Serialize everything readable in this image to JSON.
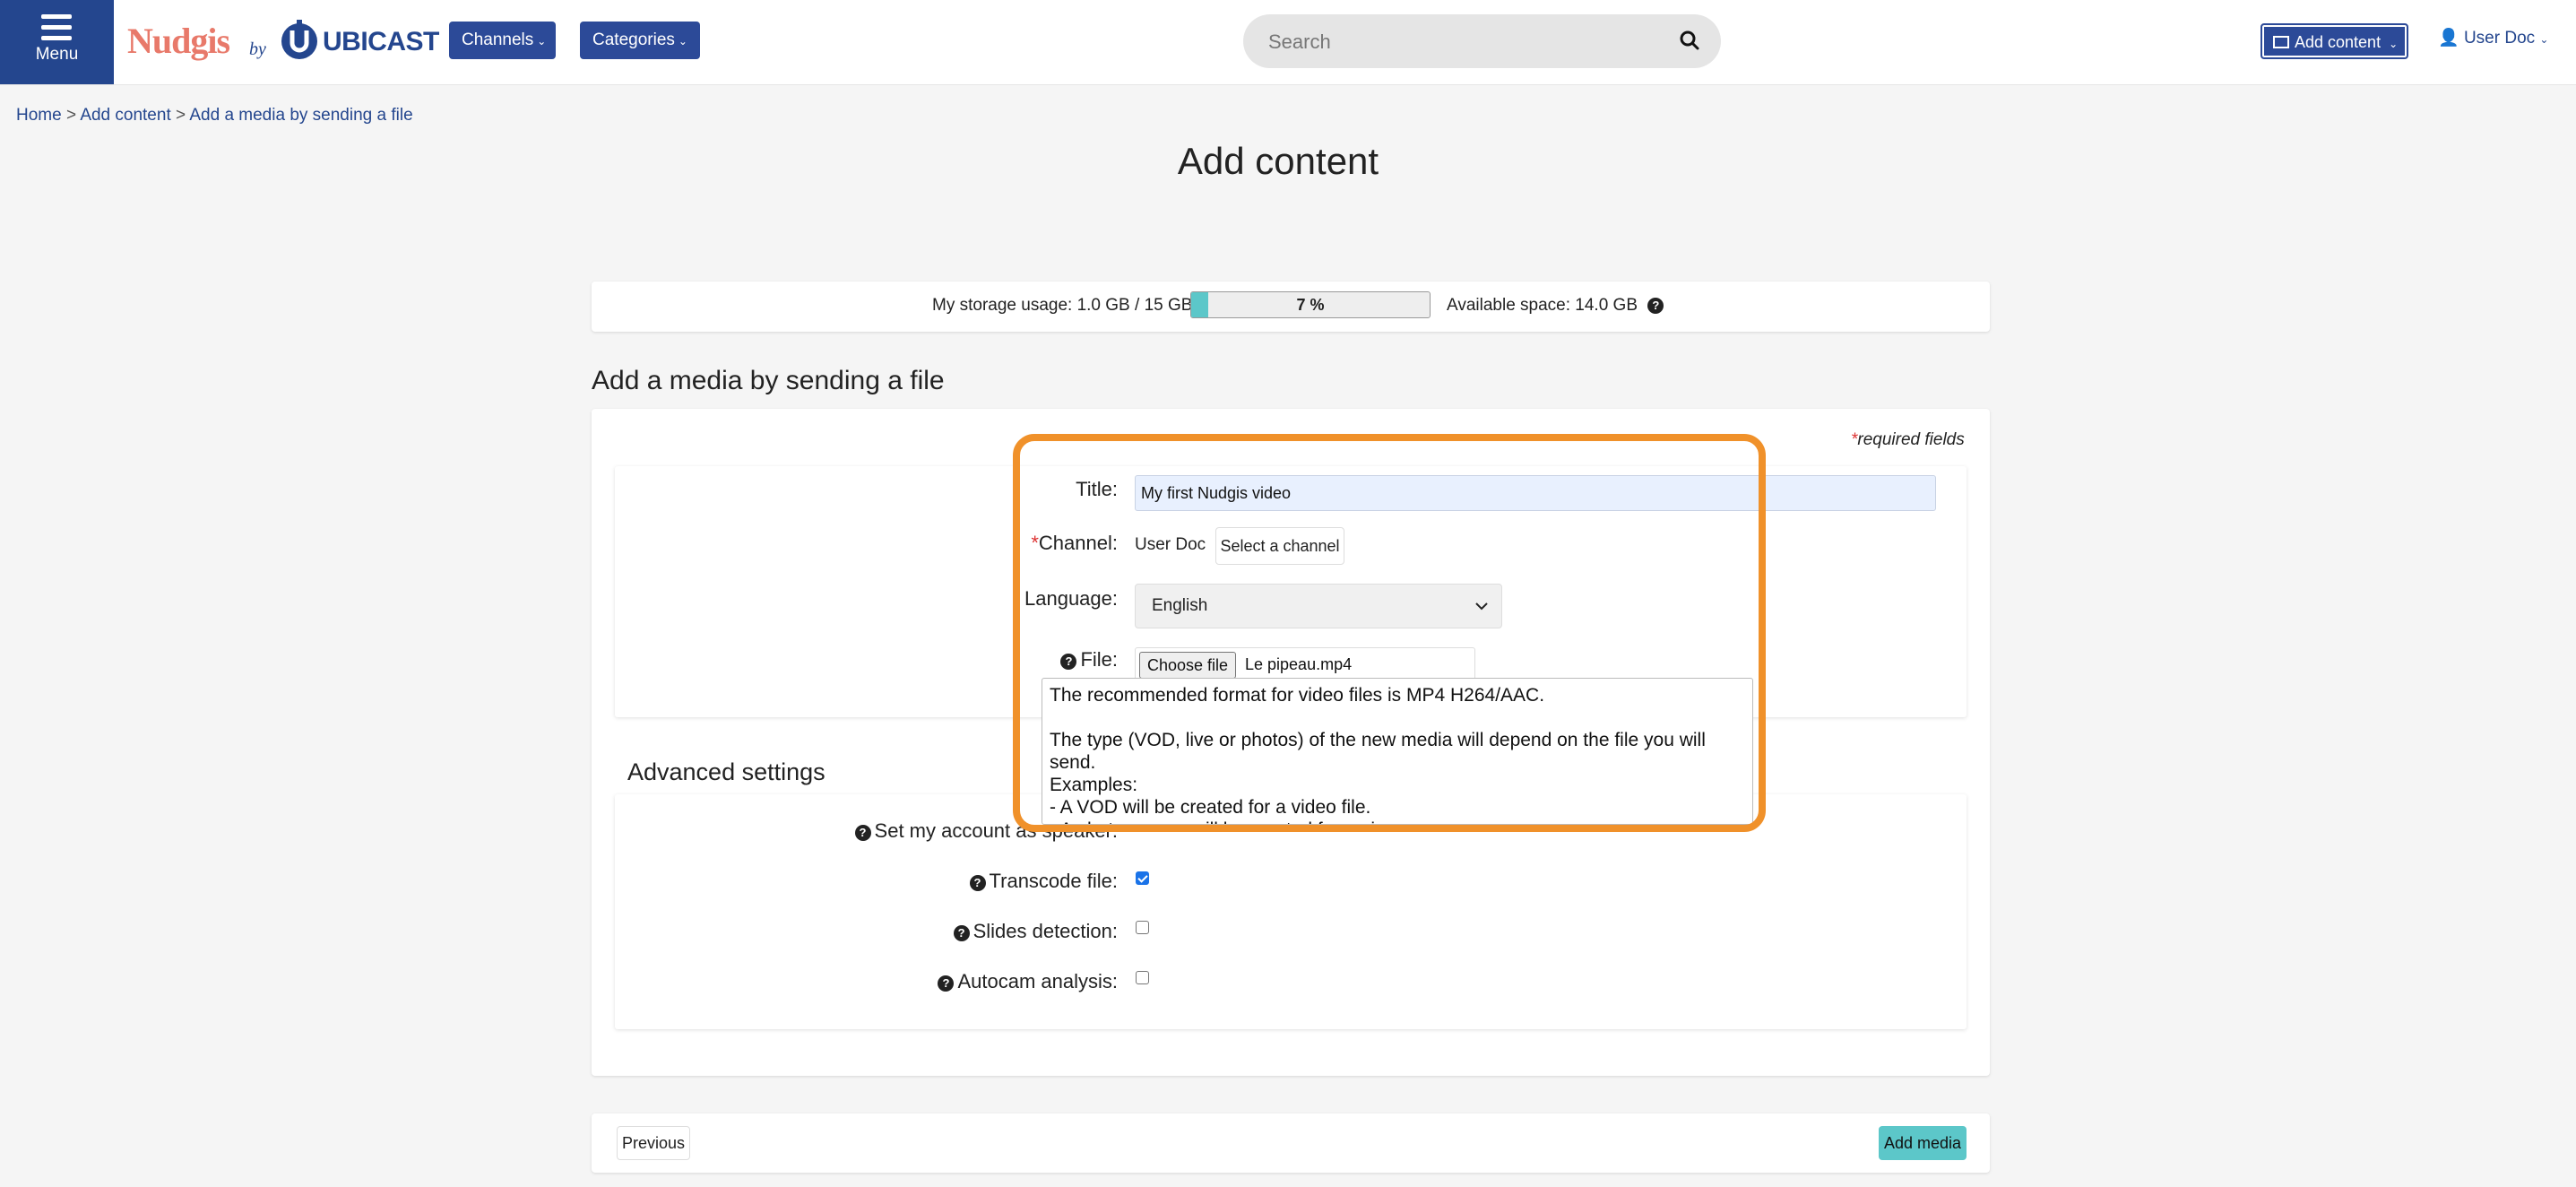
{
  "header": {
    "menu_label": "Menu",
    "logo_nudgis": "Nudgis",
    "logo_by": "by",
    "logo_ubicast": "UBICAST",
    "channels_label": "Channels",
    "categories_label": "Categories",
    "search_placeholder": "Search",
    "add_content_label": "Add content",
    "user_label": "User Doc"
  },
  "breadcrumb": {
    "items": [
      "Home",
      "Add content",
      "Add a media by sending a file"
    ],
    "separator": ">"
  },
  "page_title": "Add content",
  "storage": {
    "usage_label": "My storage usage: 1.0 GB / 15 GB",
    "percent": 7,
    "percent_label": "7 %",
    "available_label": "Available space: 14.0 GB"
  },
  "form": {
    "section_title": "Add a media by sending a file",
    "required_star": "*",
    "required_note": "required fields",
    "title_label": "Title:",
    "title_value": "My first Nudgis video",
    "channel_star": "*",
    "channel_label": "Channel:",
    "channel_value": "User Doc",
    "select_channel_label": "Select a channel",
    "language_label": "Language:",
    "language_value": "English",
    "file_label": "File:",
    "choose_file_label": "Choose file",
    "file_name": "Le pipeau.mp4",
    "tooltip_text": "The recommended format for video files is MP4 H264/AAC.\n\nThe type (VOD, live or photos) of the new media will depend on the file you will send.\nExamples:\n- A VOD will be created for a video file.\n- A photos group will be created for an image."
  },
  "advanced": {
    "title": "Advanced settings",
    "speaker_label": "Set my account as speaker:",
    "transcode_label": "Transcode file:",
    "transcode_checked": true,
    "slides_label": "Slides detection:",
    "slides_checked": false,
    "autocam_label": "Autocam analysis:",
    "autocam_checked": false
  },
  "actions": {
    "previous_label": "Previous",
    "add_media_label": "Add media"
  },
  "colors": {
    "brand_blue": "#24468e",
    "accent_teal": "#5cc7c9",
    "highlight_orange": "#f0912a",
    "logo_coral": "#e8796a"
  }
}
